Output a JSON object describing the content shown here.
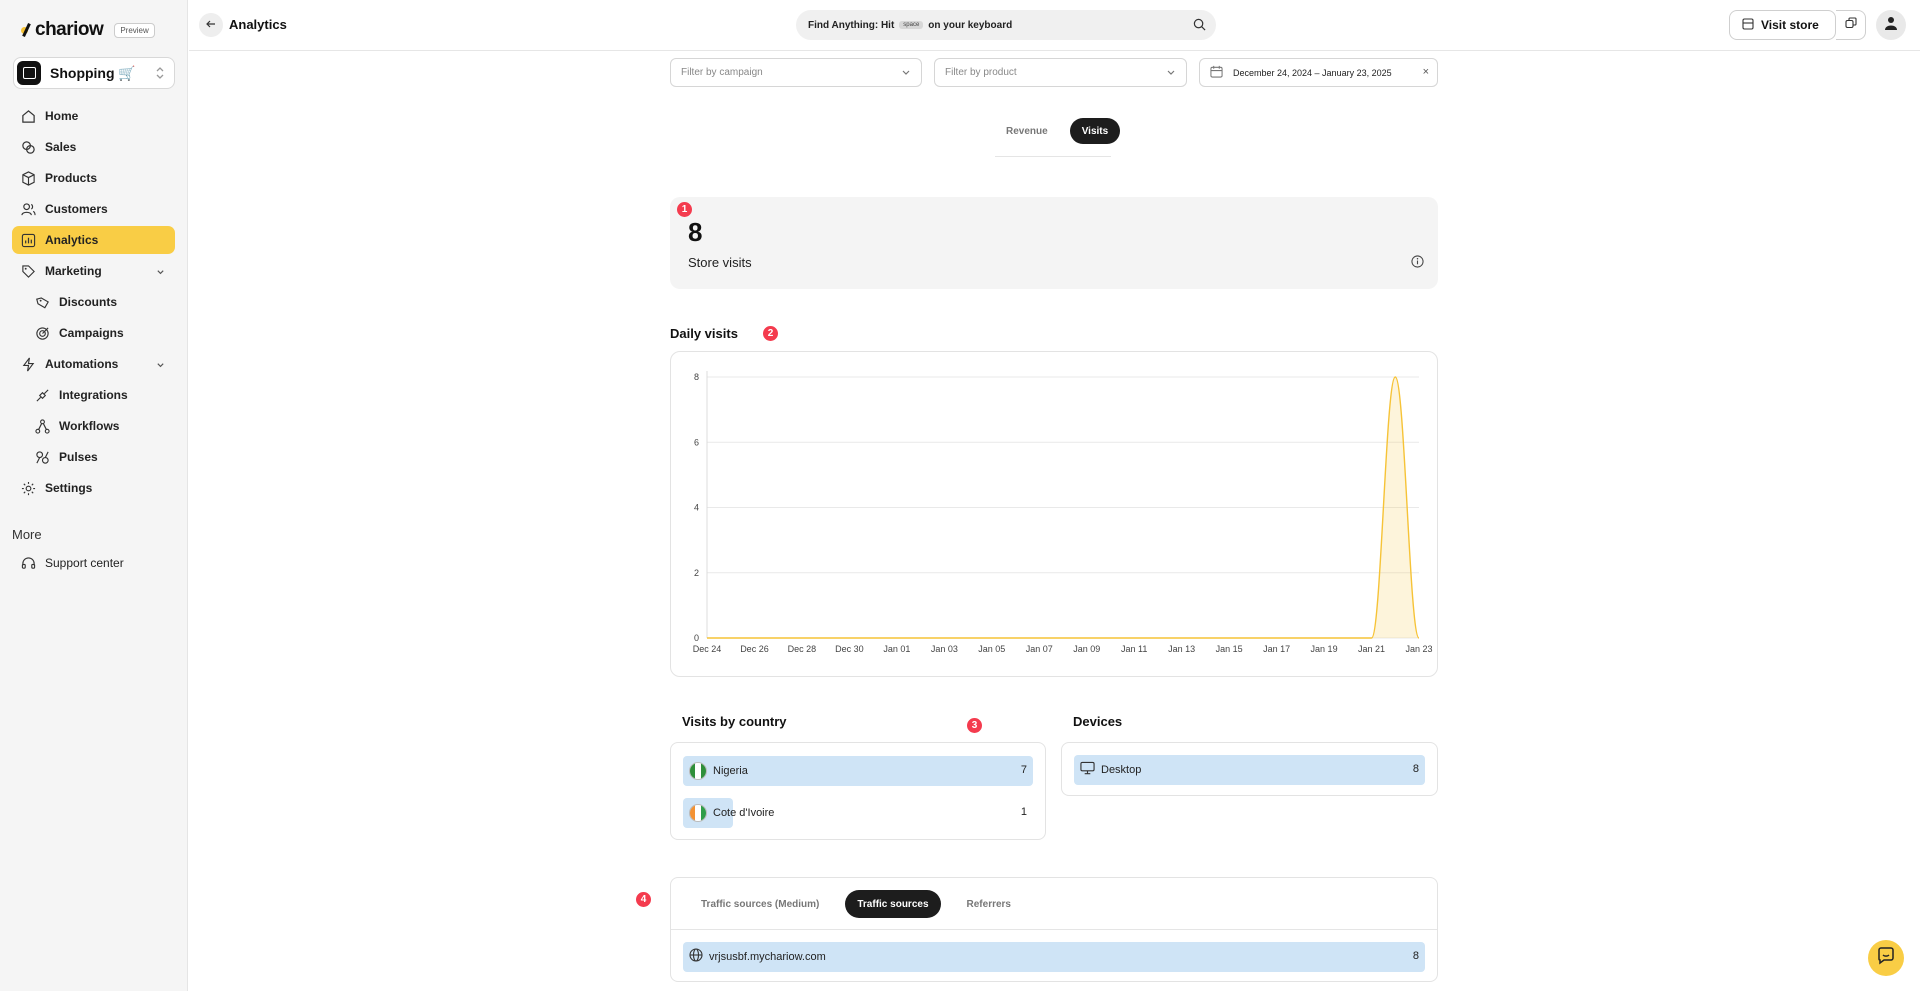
{
  "app": {
    "brand": "chariow",
    "badge": "Preview",
    "store_name": "Shopping 🛒"
  },
  "sidebar": {
    "items": [
      {
        "label": "Home",
        "icon": "home-icon",
        "active": false
      },
      {
        "label": "Sales",
        "icon": "coins-icon",
        "active": false
      },
      {
        "label": "Products",
        "icon": "box-icon",
        "active": false
      },
      {
        "label": "Customers",
        "icon": "users-icon",
        "active": false
      },
      {
        "label": "Analytics",
        "icon": "chart-bar-icon",
        "active": true
      },
      {
        "label": "Marketing",
        "icon": "tag-icon",
        "active": false,
        "expandable": true
      },
      {
        "label": "Discounts",
        "icon": "discount-tag-icon",
        "sub": true
      },
      {
        "label": "Campaigns",
        "icon": "target-icon",
        "sub": true
      },
      {
        "label": "Automations",
        "icon": "bolt-icon",
        "active": false,
        "expandable": true
      },
      {
        "label": "Integrations",
        "icon": "plug-icon",
        "sub": true
      },
      {
        "label": "Workflows",
        "icon": "workflow-icon",
        "sub": true
      },
      {
        "label": "Pulses",
        "icon": "pulses-icon",
        "sub": true
      },
      {
        "label": "Settings",
        "icon": "gear-icon",
        "active": false
      }
    ],
    "more_label": "More",
    "support_label": "Support center"
  },
  "header": {
    "title": "Analytics",
    "search_prefix": "Find Anything: Hit",
    "search_key": "space",
    "search_suffix": "on your keyboard",
    "visit_store": "Visit store"
  },
  "filters": {
    "campaign_placeholder": "Filter by campaign",
    "product_placeholder": "Filter by product",
    "date_range": "December 24, 2024 – January 23, 2025"
  },
  "segment": {
    "options": [
      "Revenue",
      "Visits"
    ],
    "active": "Visits"
  },
  "markers": [
    "1",
    "2",
    "3",
    "4"
  ],
  "stat": {
    "value": "8",
    "label": "Store visits"
  },
  "daily_visits_title": "Daily visits",
  "chart_data": {
    "type": "area",
    "title": "Daily visits",
    "x": [
      "Dec 24",
      "Dec 25",
      "Dec 26",
      "Dec 27",
      "Dec 28",
      "Dec 29",
      "Dec 30",
      "Dec 31",
      "Jan 01",
      "Jan 02",
      "Jan 03",
      "Jan 04",
      "Jan 05",
      "Jan 06",
      "Jan 07",
      "Jan 08",
      "Jan 09",
      "Jan 10",
      "Jan 11",
      "Jan 12",
      "Jan 13",
      "Jan 14",
      "Jan 15",
      "Jan 16",
      "Jan 17",
      "Jan 18",
      "Jan 19",
      "Jan 20",
      "Jan 21",
      "Jan 22",
      "Jan 23"
    ],
    "tick_labels": [
      "Dec 24",
      "Dec 26",
      "Dec 28",
      "Dec 30",
      "Jan 01",
      "Jan 03",
      "Jan 05",
      "Jan 07",
      "Jan 09",
      "Jan 11",
      "Jan 13",
      "Jan 15",
      "Jan 17",
      "Jan 19",
      "Jan 21",
      "Jan 23"
    ],
    "series": [
      {
        "values": [
          0,
          0,
          0,
          0,
          0,
          0,
          0,
          0,
          0,
          0,
          0,
          0,
          0,
          0,
          0,
          0,
          0,
          0,
          0,
          0,
          0,
          0,
          0,
          0,
          0,
          0,
          0,
          0,
          0,
          8,
          0
        ]
      }
    ],
    "ylim": [
      0,
      8
    ],
    "yticks": [
      0,
      2,
      4,
      6,
      8
    ],
    "grid": true,
    "color": "#f6c337"
  },
  "countries": {
    "title": "Visits by country",
    "max": 7,
    "rows": [
      {
        "name": "Nigeria",
        "value": 7,
        "flag": [
          "#2f8f3a",
          "#ffffff",
          "#2f8f3a"
        ]
      },
      {
        "name": "Cote d'Ivoire",
        "value": 1,
        "flag": [
          "#f39233",
          "#ffffff",
          "#2f9e4a"
        ]
      }
    ]
  },
  "devices": {
    "title": "Devices",
    "rows": [
      {
        "name": "Desktop",
        "value": 8,
        "icon": "monitor-icon"
      }
    ]
  },
  "traffic": {
    "tabs": [
      "Traffic sources (Medium)",
      "Traffic sources",
      "Referrers"
    ],
    "active": "Traffic sources",
    "rows": [
      {
        "name": "vrjsusbf.mychariow.com",
        "value": 8,
        "icon": "globe-icon"
      }
    ]
  }
}
